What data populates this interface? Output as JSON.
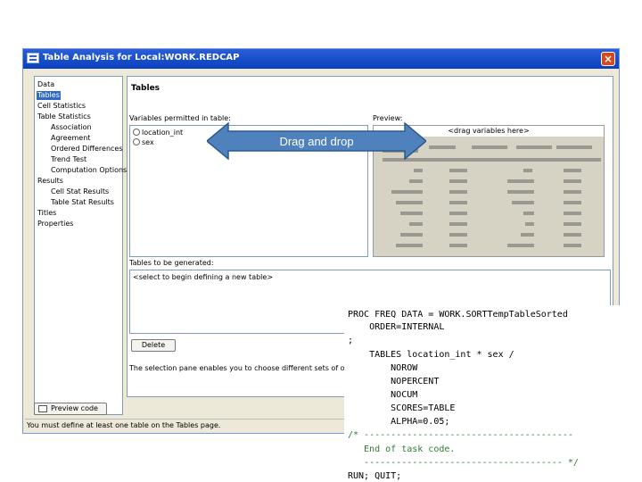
{
  "window": {
    "title": "Table Analysis for Local:WORK.REDCAP",
    "close_glyph": "×"
  },
  "nav": {
    "items": [
      {
        "label": "Data"
      },
      {
        "label": "Tables"
      },
      {
        "label": "Cell Statistics"
      },
      {
        "label": "Table Statistics"
      },
      {
        "label": "Association"
      },
      {
        "label": "Agreement"
      },
      {
        "label": "Ordered Differences"
      },
      {
        "label": "Trend Test"
      },
      {
        "label": "Computation Options"
      },
      {
        "label": "Results"
      },
      {
        "label": "Cell Stat Results"
      },
      {
        "label": "Table Stat Results"
      },
      {
        "label": "Titles"
      },
      {
        "label": "Properties"
      }
    ],
    "selected": "Tables"
  },
  "tables_section": {
    "title": "Tables",
    "variables_label": "Variables permitted in table:",
    "variables": [
      "location_int",
      "sex"
    ],
    "preview_label": "Preview:",
    "preview_header": "<drag variables here>",
    "to_generate_label": "Tables to be generated:",
    "table_placeholder": "<select to begin defining a new table>",
    "delete_button": "Delete",
    "description": "The selection pane enables you to choose different sets of options for"
  },
  "preview_code_button": "Preview code",
  "status_text": "You must define at least one table on the Tables page.",
  "annotation": {
    "label": "Drag and drop",
    "color": "#4f81bd"
  },
  "code": {
    "lines": [
      "PROC FREQ DATA = WORK.SORTTempTableSorted",
      "    ORDER=INTERNAL",
      ";",
      "    TABLES location_int * sex /",
      "        NOROW",
      "        NOPERCENT",
      "        NOCUM",
      "        SCORES=TABLE",
      "        ALPHA=0.05;",
      "/* ---------------------------------------",
      "   End of task code.",
      "   ------------------------------------- */",
      "RUN; QUIT;"
    ]
  }
}
